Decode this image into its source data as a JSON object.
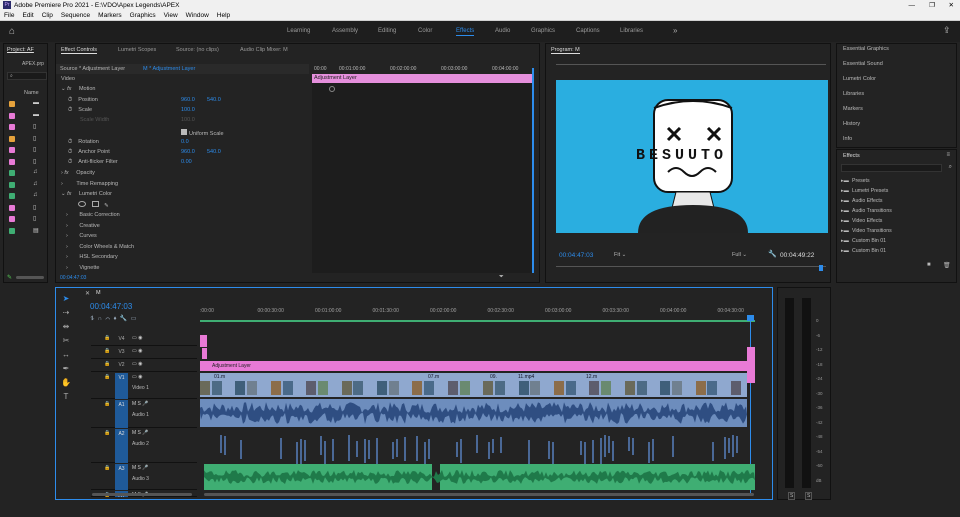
{
  "window": {
    "title": "Adobe Premiere Pro 2021 - E:\\VDO\\Apex Legends\\APEX"
  },
  "menu": [
    "File",
    "Edit",
    "Clip",
    "Sequence",
    "Markers",
    "Graphics",
    "View",
    "Window",
    "Help"
  ],
  "workspaces": [
    "Learning",
    "Assembly",
    "Editing",
    "Color",
    "Effects",
    "Audio",
    "Graphics",
    "Captions",
    "Libraries"
  ],
  "active_workspace": "Effects",
  "project": {
    "tab": "Project: AF",
    "file": "APEX.prp",
    "name_header": "Name"
  },
  "effect_controls": {
    "tabs": [
      "Effect Controls",
      "Lumetri Scopes",
      "Source: (no clips)",
      "Audio Clip Mixer: M"
    ],
    "source": "Source * Adjustment Layer",
    "clip": "M * Adjustment Layer",
    "ruler": [
      "00:00",
      "00:01:00:00",
      "00:02:00:00",
      "00:03:00:00",
      "00:04:00:00"
    ],
    "clip_bar": "Adjustment Layer",
    "video_label": "Video",
    "motion": "Motion",
    "position_label": "Position",
    "position_x": "960.0",
    "position_y": "540.0",
    "scale_label": "Scale",
    "scale_val": "100.0",
    "scale_width_label": "Scale Width",
    "scale_width_val": "100.0",
    "uniform_scale": "Uniform Scale",
    "rotation_label": "Rotation",
    "rotation_val": "0.0",
    "anchor_label": "Anchor Point",
    "anchor_x": "960.0",
    "anchor_y": "540.0",
    "antiflicker_label": "Anti-flicker Filter",
    "antiflicker_val": "0.00",
    "opacity": "Opacity",
    "time_remap": "Time Remapping",
    "lumetri": "Lumetri Color",
    "lumetri_items": [
      "Basic Correction",
      "Creative",
      "Curves",
      "Color Wheels & Match",
      "HSL Secondary",
      "Vignette"
    ],
    "timecode": "00:04:47:03"
  },
  "program": {
    "tab": "Program: M",
    "timecode": "00:04:47:03",
    "fit": "Fit",
    "quality": "Full",
    "duration": "00:04:49:22",
    "brand_text": "BESUUTO"
  },
  "right_panel": {
    "items": [
      "Essential Graphics",
      "Essential Sound",
      "Lumetri Color",
      "Libraries",
      "Markers",
      "History",
      "Info"
    ],
    "effects_title": "Effects",
    "effects_items": [
      "Presets",
      "Lumetri Presets",
      "Audio Effects",
      "Audio Transitions",
      "Video Effects",
      "Video Transitions",
      "Custom Bin 01",
      "Custom Bin 01"
    ]
  },
  "timeline": {
    "tab": "M",
    "timecode": "00:04:47:03",
    "ruler": [
      ":00:00",
      "00:00:30:00",
      "00:01:00:00",
      "00:01:30:00",
      "00:02:00:00",
      "00:02:30:00",
      "00:03:00:00",
      "00:03:30:00",
      "00:04:00:00",
      "00:04:30:00"
    ],
    "tracks": [
      "V4",
      "V3",
      "V2",
      "V1",
      "A1",
      "A2",
      "A3",
      "A4"
    ],
    "track_names": {
      "v1": "Video 1",
      "a1": "Audio 1",
      "a2": "Audio 2",
      "a3": "Audio 3"
    },
    "adjustment": "Adjustment Layer",
    "clip_labels": [
      "01.m",
      "07.m",
      "09.",
      "11.mp4",
      "12.m"
    ],
    "meter": [
      "0",
      "-6",
      "-12",
      "-18",
      "-24",
      "-30",
      "-36",
      "-42",
      "-48",
      "-54",
      "-60",
      "dB"
    ],
    "meter_solo": [
      "S",
      "S"
    ]
  },
  "colors": {
    "accent": "#2d8ceb",
    "pink": "#e87ad6",
    "video": "#8fa8cf",
    "audio": "#4a6896",
    "green": "#3fae73",
    "monitor_bg": "#2aaee0"
  }
}
